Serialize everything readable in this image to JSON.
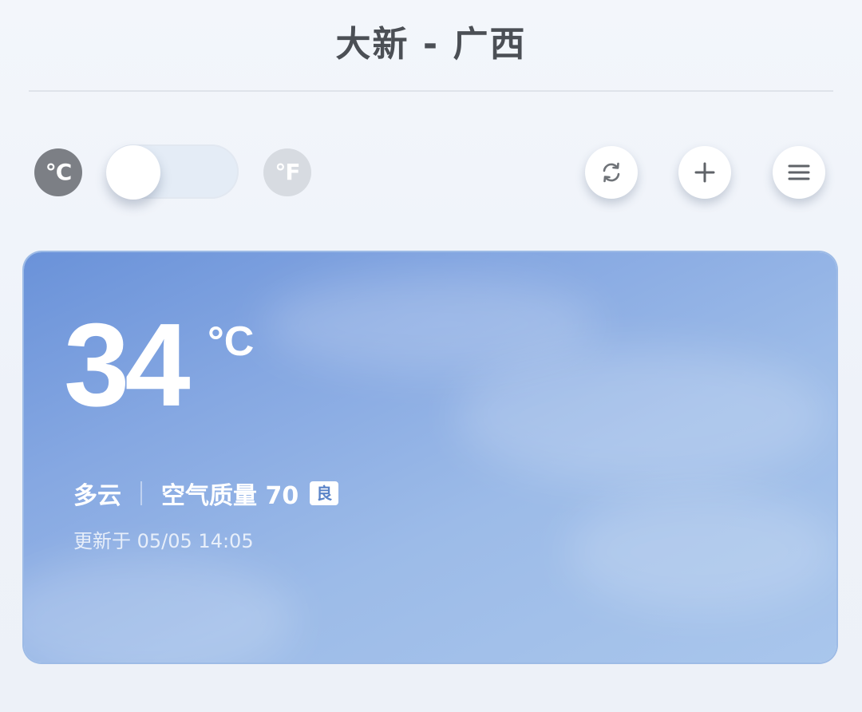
{
  "header": {
    "title": "大新 - 广西"
  },
  "controls": {
    "unit_celsius": "°C",
    "unit_fahrenheit": "°F",
    "unit_toggle_state": "celsius",
    "buttons": [
      {
        "name": "refresh",
        "icon": "refresh-icon"
      },
      {
        "name": "add",
        "icon": "plus-icon"
      },
      {
        "name": "menu",
        "icon": "menu-icon"
      }
    ]
  },
  "weather": {
    "temperature": "34",
    "temperature_unit": "°C",
    "condition": "多云",
    "air_quality_label": "空气质量 70",
    "air_quality_level": "良",
    "updated": "更新于 05/05 14:05"
  },
  "colors": {
    "card_blue": "#86a8e2",
    "active_unit": "#7c7f85",
    "inactive_unit": "#d7dbe1"
  }
}
